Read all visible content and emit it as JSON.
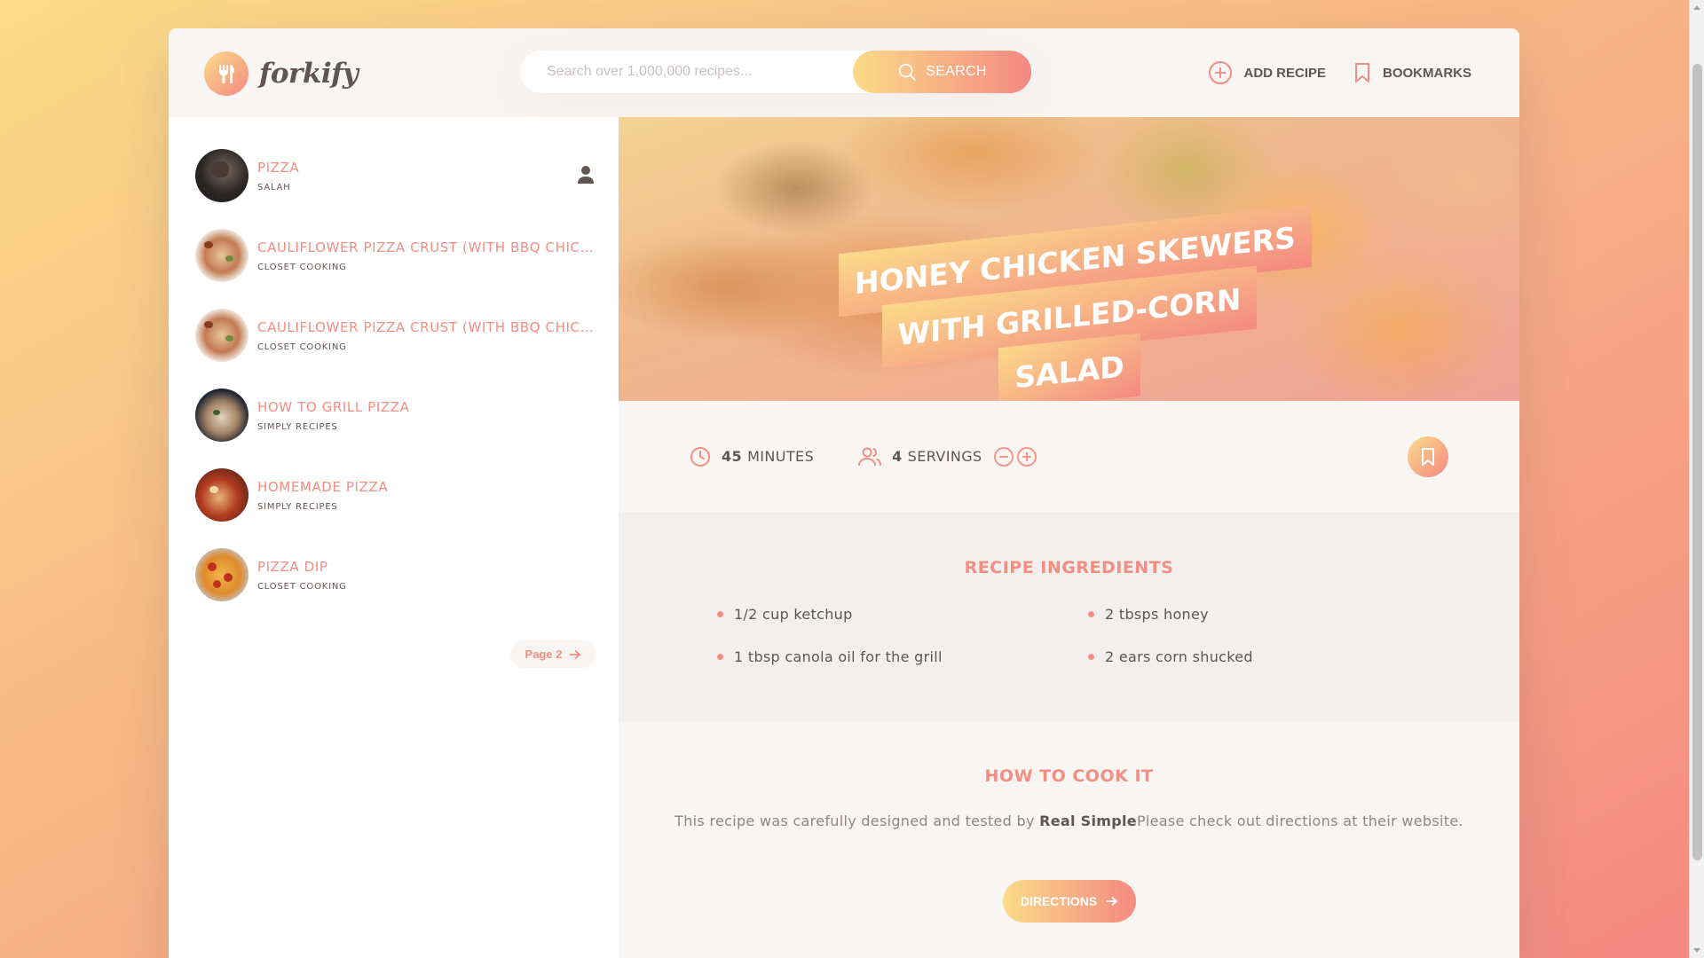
{
  "header": {
    "logo_text": "forkify",
    "search_placeholder": "Search over 1,000,000 recipes...",
    "search_label": "SEARCH",
    "add_recipe_label": "ADD RECIPE",
    "bookmarks_label": "BOOKMARKS"
  },
  "results": [
    {
      "title": "PIZZA",
      "publisher": "SALAH"
    },
    {
      "title": "CAULIFLOWER PIZZA CRUST (WITH BBQ CHICKEN PIZZA)",
      "publisher": "CLOSET COOKING"
    },
    {
      "title": "CAULIFLOWER PIZZA CRUST (WITH BBQ CHICKEN PIZZA)",
      "publisher": "CLOSET COOKING"
    },
    {
      "title": "HOW TO GRILL PIZZA",
      "publisher": "SIMPLY RECIPES"
    },
    {
      "title": "HOMEMADE PIZZA",
      "publisher": "SIMPLY RECIPES"
    },
    {
      "title": "PIZZA DIP",
      "publisher": "CLOSET COOKING"
    }
  ],
  "pagination": {
    "next_label": "Page 2"
  },
  "recipe": {
    "title": "HONEY CHICKEN SKEWERS WITH GRILLED-CORN SALAD",
    "minutes_value": "45",
    "minutes_label": "MINUTES",
    "servings_value": "4",
    "servings_label": "SERVINGS",
    "ingredients_heading": "RECIPE INGREDIENTS",
    "ingredients": [
      "1/2 cup ketchup",
      "2 tbsps honey",
      "1 tbsp canola oil for the grill",
      "2 ears corn shucked"
    ],
    "directions_heading": "HOW TO COOK IT",
    "directions_text_before": "This recipe was carefully designed and tested by ",
    "directions_publisher": "Real Simple",
    "directions_text_after": "Please check out directions at their website.",
    "directions_button": "DIRECTIONS"
  },
  "colors": {
    "accent": "#f38e82",
    "gradient_start": "#fbdb89",
    "gradient_end": "#f48982",
    "text": "#615551"
  }
}
